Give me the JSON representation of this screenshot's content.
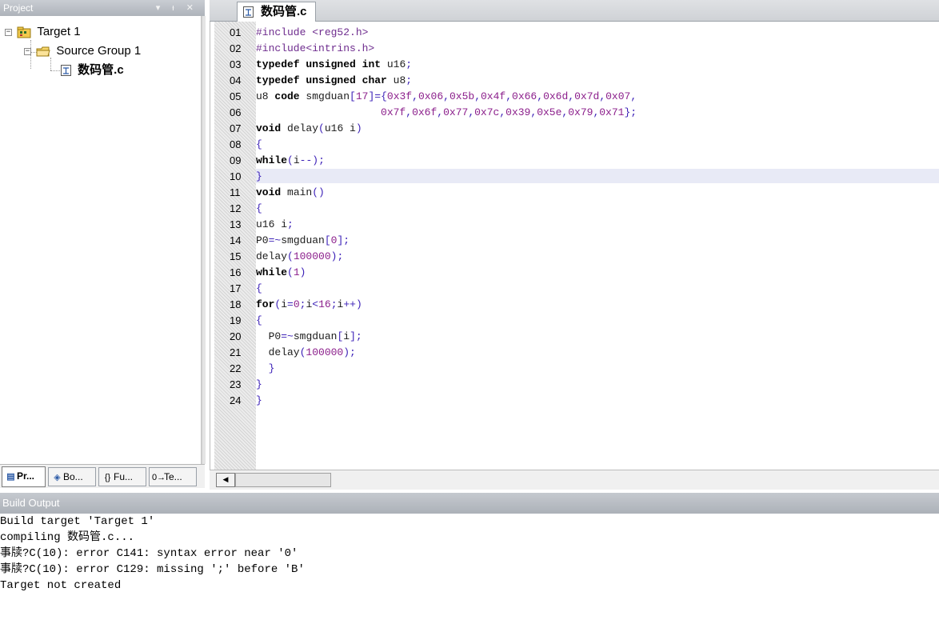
{
  "project_pane": {
    "title": "Project",
    "controls": "▾ ᵼ ✕",
    "tree": {
      "target": "Target 1",
      "group": "Source Group 1",
      "file": "数码管.c"
    },
    "tabs": [
      "Pr...",
      "Bo...",
      "Fu...",
      "Te..."
    ]
  },
  "editor": {
    "tab_label": "数码管.c",
    "highlighted_line": "10",
    "line_numbers": [
      "01",
      "02",
      "03",
      "04",
      "05",
      "06",
      "07",
      "08",
      "09",
      "10",
      "11",
      "12",
      "13",
      "14",
      "15",
      "16",
      "17",
      "18",
      "19",
      "20",
      "21",
      "22",
      "23",
      "24"
    ],
    "lines": [
      "#include <reg52.h>",
      "#include<intrins.h>",
      "typedef unsigned int u16;",
      "typedef unsigned char u8;",
      "u8 code smgduan[17]={0x3f,0x06,0x5b,0x4f,0x66,0x6d,0x7d,0x07,",
      "                    0x7f,0x6f,0x77,0x7c,0x39,0x5e,0x79,0x71};",
      "void delay(u16 i)",
      "{",
      "while(i--);",
      "}",
      "void main()",
      "{",
      "u16 i;",
      "P0=~smgduan[0];",
      "delay(100000);",
      "while(1)",
      "{",
      "for(i=0;i<16;i++)",
      "{",
      "  P0=~smgduan[i];",
      "  delay(100000);",
      "  }",
      "}",
      "}"
    ]
  },
  "build_output": {
    "title": "Build Output",
    "lines": [
      "Build target 'Target 1'",
      "compiling 数码管.c...",
      "事牍?C(10): error C141: syntax error near '0'",
      "事牍?C(10): error C129: missing ';' before 'B'",
      "Target not created"
    ]
  },
  "colors": {
    "keyword": "#000000",
    "preprocessor": "#6e2c8e",
    "number": "#8b1e8b",
    "operator": "#3d22b8",
    "current_line": "#e8eaf6",
    "title_bar": "#b9bdc3"
  },
  "icons": {
    "target": "target-folder-icon",
    "group": "folder-icon",
    "file": "c-source-file-icon",
    "tab_project": "project-tab-icon",
    "tab_books": "books-tab-icon",
    "tab_functions": "functions-tab-icon",
    "tab_templates": "templates-tab-icon"
  }
}
